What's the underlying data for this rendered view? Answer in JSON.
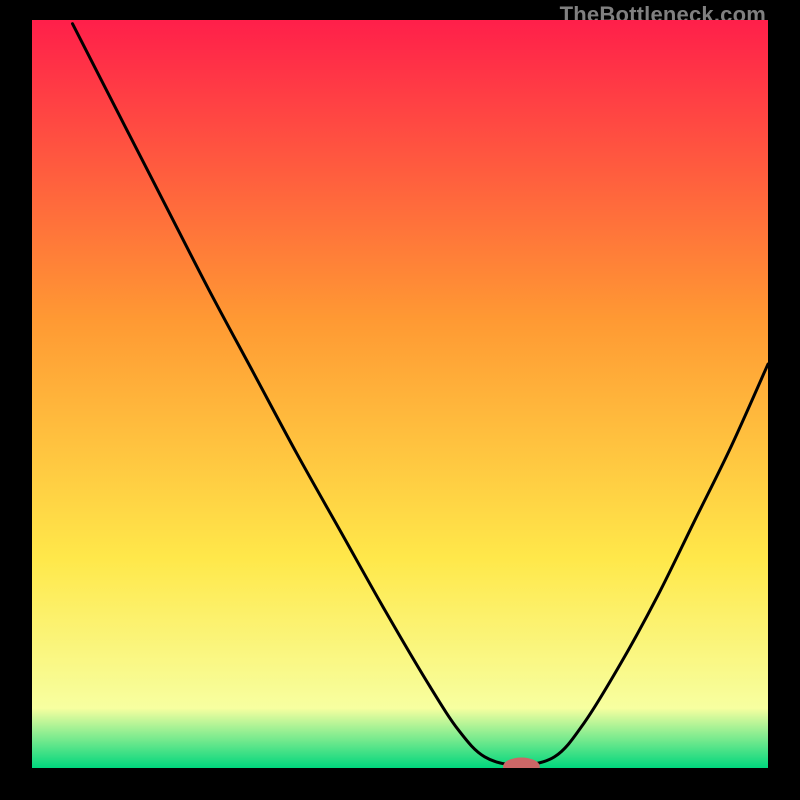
{
  "watermark": "TheBottleneck.com",
  "chart_data": {
    "type": "line",
    "title": "",
    "xlabel": "",
    "ylabel": "",
    "xlim": [
      0,
      1
    ],
    "ylim": [
      0,
      1
    ],
    "background_gradient": {
      "top": "#ff1f4a",
      "mid_upper": "#ff9933",
      "mid_lower": "#ffe84a",
      "near_bottom": "#f7ffa0",
      "bottom": "#00d67d"
    },
    "series": [
      {
        "name": "bottleneck-curve",
        "color": "#000000",
        "points": [
          {
            "x": 0.055,
            "y": 0.995
          },
          {
            "x": 0.12,
            "y": 0.87
          },
          {
            "x": 0.18,
            "y": 0.755
          },
          {
            "x": 0.24,
            "y": 0.64
          },
          {
            "x": 0.3,
            "y": 0.53
          },
          {
            "x": 0.36,
            "y": 0.42
          },
          {
            "x": 0.42,
            "y": 0.315
          },
          {
            "x": 0.48,
            "y": 0.21
          },
          {
            "x": 0.54,
            "y": 0.11
          },
          {
            "x": 0.58,
            "y": 0.05
          },
          {
            "x": 0.615,
            "y": 0.015
          },
          {
            "x": 0.66,
            "y": 0.004
          },
          {
            "x": 0.71,
            "y": 0.015
          },
          {
            "x": 0.75,
            "y": 0.06
          },
          {
            "x": 0.8,
            "y": 0.14
          },
          {
            "x": 0.85,
            "y": 0.23
          },
          {
            "x": 0.9,
            "y": 0.33
          },
          {
            "x": 0.95,
            "y": 0.43
          },
          {
            "x": 1.0,
            "y": 0.54
          }
        ]
      }
    ],
    "marker": {
      "name": "optimal-marker",
      "color": "#cc6666",
      "x": 0.665,
      "y": 0.002,
      "rx": 0.025,
      "ry": 0.012
    }
  }
}
